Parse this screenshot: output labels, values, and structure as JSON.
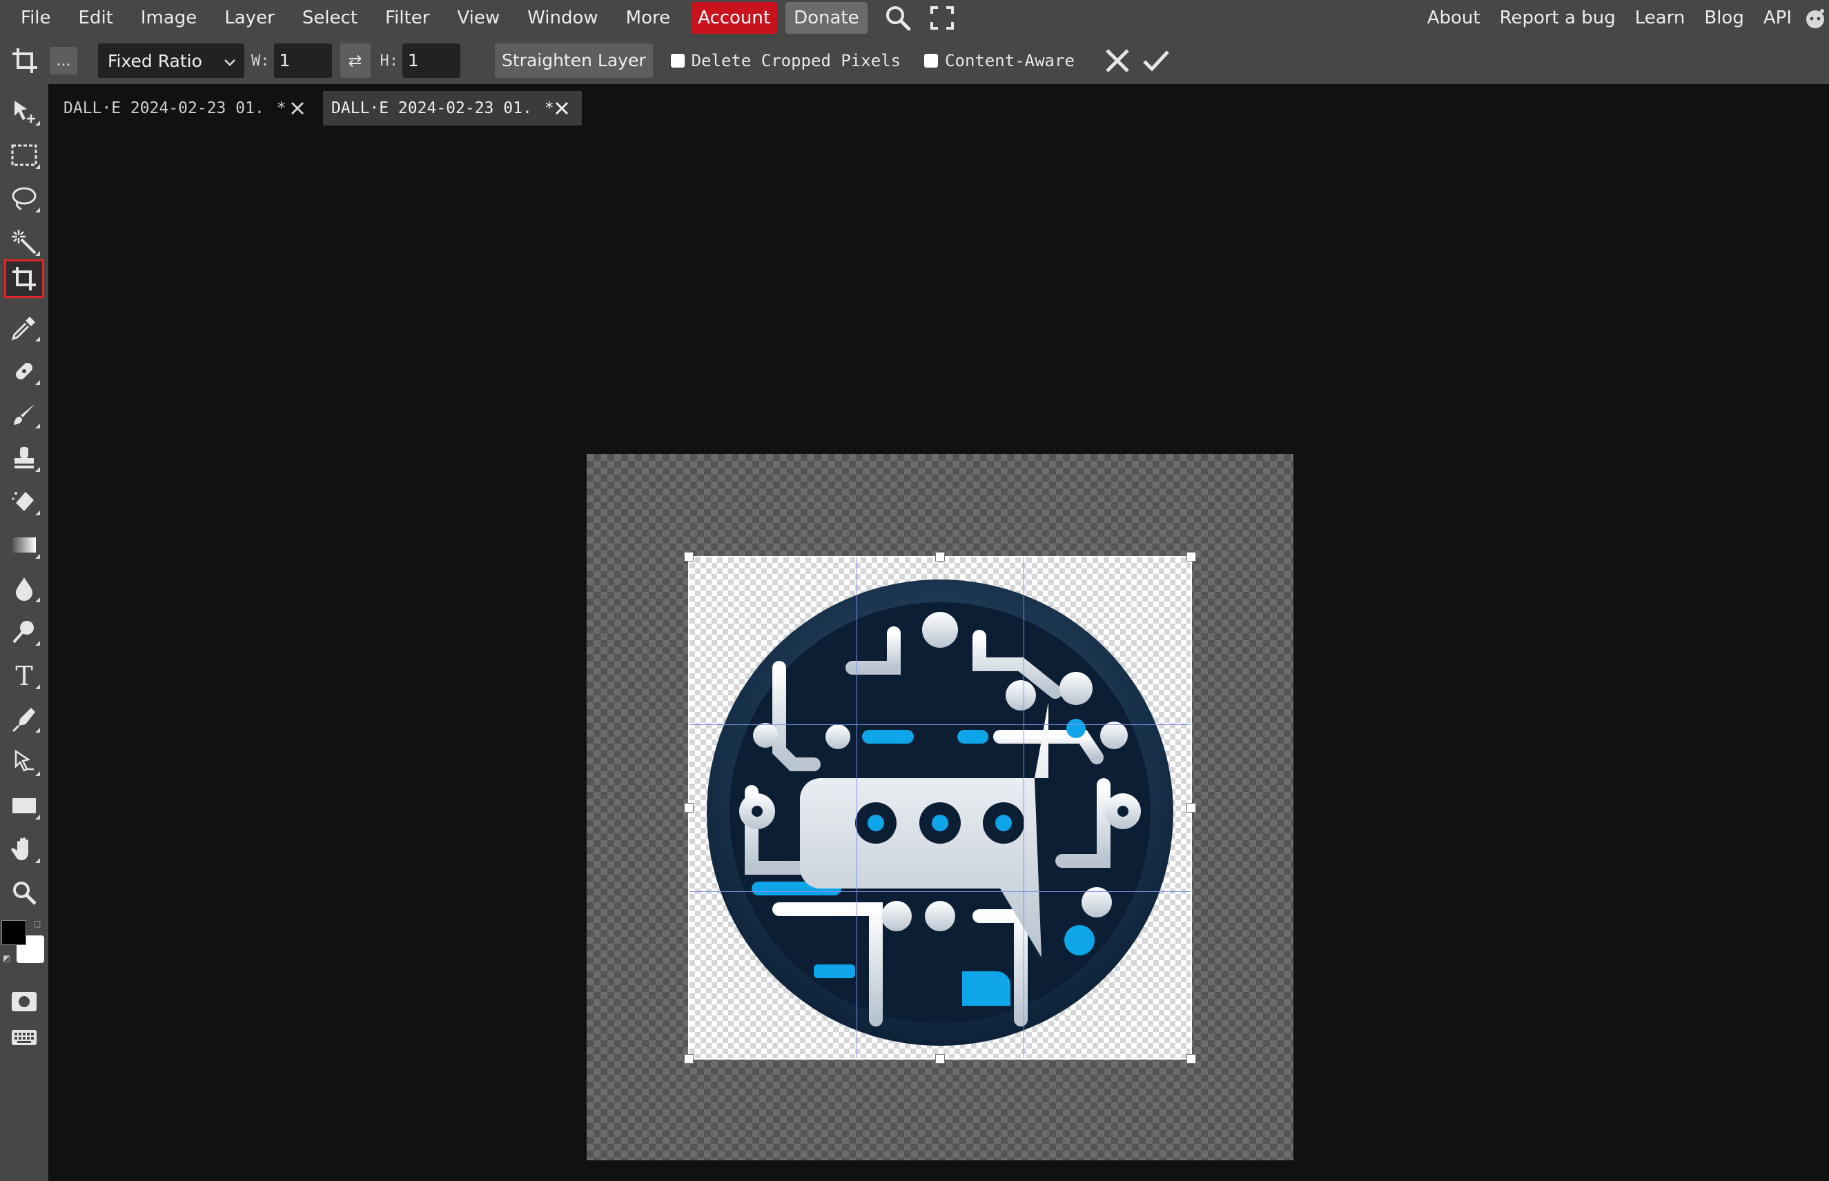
{
  "menu": {
    "items": [
      "File",
      "Edit",
      "Image",
      "Layer",
      "Select",
      "Filter",
      "View",
      "Window",
      "More"
    ],
    "account": "Account",
    "donate": "Donate",
    "right_items": [
      "About",
      "Report a bug",
      "Learn",
      "Blog",
      "API"
    ]
  },
  "options": {
    "more_label": "...",
    "ratio_mode": "Fixed Ratio",
    "width_label": "W:",
    "width_value": "1",
    "height_label": "H:",
    "height_value": "1",
    "straighten_label": "Straighten Layer",
    "delete_cropped_label": "Delete Cropped Pixels",
    "delete_cropped_checked": false,
    "content_aware_label": "Content-Aware",
    "content_aware_checked": false
  },
  "tabs": [
    {
      "name": "DALL·E 2024-02-23 01.",
      "modified": "*",
      "active": false
    },
    {
      "name": "DALL·E 2024-02-23 01.",
      "modified": "*",
      "active": true
    }
  ],
  "tools": [
    "move",
    "marquee",
    "lasso",
    "magic-wand",
    "crop",
    "eyedropper",
    "healing",
    "brush",
    "stamp",
    "eraser",
    "gradient",
    "blur",
    "dodge",
    "type",
    "pen",
    "path-select",
    "rectangle",
    "hand",
    "zoom"
  ],
  "active_tool": "crop",
  "colors": {
    "foreground": "#000000",
    "background": "#ffffff",
    "accent_red": "#c8131c",
    "crop_grid": "#7b8fe8",
    "logo_navy": "#0d2238",
    "logo_blue": "#0ea5e9"
  }
}
